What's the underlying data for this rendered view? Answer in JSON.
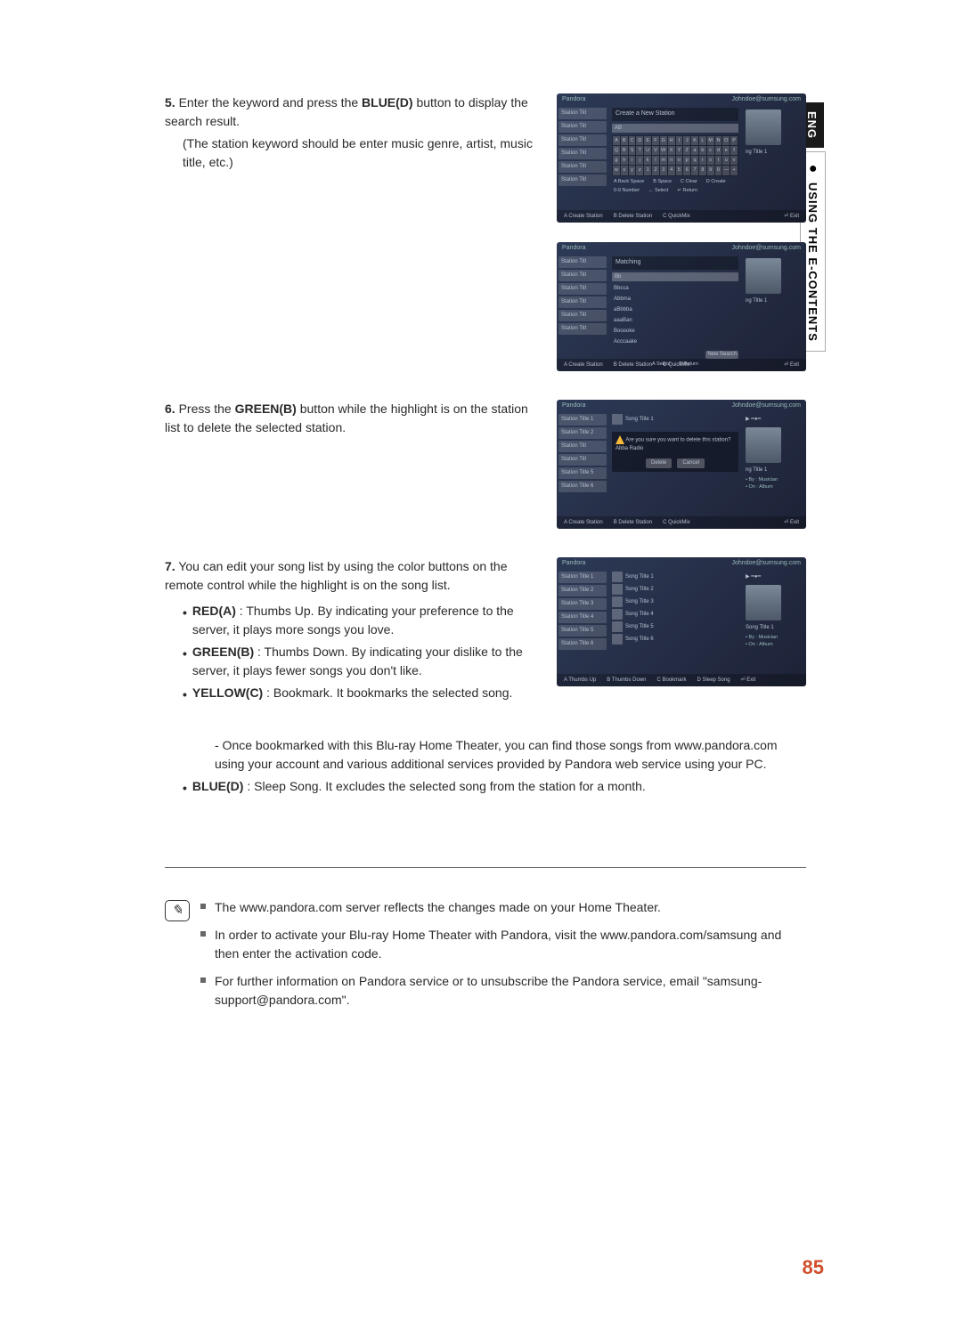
{
  "sidebar": {
    "lang": "ENG",
    "section": "USING THE E-CONTENTS"
  },
  "step5": {
    "num": "5.",
    "text1": "Enter the keyword and press the ",
    "blue": "BLUE(D)",
    "text2": " button to display the search result.",
    "sub": "(The station keyword should be enter music genre, artist, music title, etc.)"
  },
  "step6": {
    "num": "6.",
    "text1": "Press the ",
    "green": "GREEN(B)",
    "text2": " button while the highlight is on the station list to delete the selected station."
  },
  "step7": {
    "num": "7.",
    "intro": "You can edit your song list by using the color buttons on the remote control while the highlight is on the song list.",
    "red_label": "RED(A)",
    "red_text": " : Thumbs Up. By indicating your preference to the server, it plays more songs you love.",
    "green_label": "GREEN(B)",
    "green_text": " : Thumbs Down. By indicating your dislike to the server, it plays fewer songs you don't like.",
    "yellow_label": "YELLOW(C)",
    "yellow_text": " : Bookmark. It bookmarks the selected song.",
    "yellow_sub": "- Once bookmarked with this Blu-ray Home Theater, you can find those songs from www.pandora.com using your account and various additional services provided by Pandora web service using your PC.",
    "blue_label": "BLUE(D)",
    "blue_text": " : Sleep Song. It excludes the selected song from the station for a month."
  },
  "notes": {
    "n1": "The www.pandora.com server reflects the changes made on your Home Theater.",
    "n2": "In order to activate your Blu-ray Home Theater with Pandora, visit the www.pandora.com/samsung and then enter the activation code.",
    "n3": "For further information on Pandora service or to unsubscribe the Pandora service, email \"samsung-support@pandora.com\"."
  },
  "scr": {
    "app": "Pandora",
    "account": "Johndoe@sumsung.com",
    "stations": [
      "Station Titl",
      "Station Titl",
      "Station Titl",
      "Station Titl",
      "Station Titl",
      "Station Titl"
    ],
    "stations_full": [
      "Station Title 1",
      "Station Title 2",
      "Station Title 3",
      "Station Title 4",
      "Station Title 5",
      "Station Title 6"
    ],
    "create_title": "Create a New Station",
    "input": "AB",
    "keys": [
      "A",
      "B",
      "C",
      "D",
      "E",
      "F",
      "G",
      "H",
      "I",
      "J",
      "K",
      "L",
      "M",
      "N",
      "O",
      "P",
      "Q",
      "R",
      "S",
      "T",
      "U",
      "V",
      "W",
      "X",
      "Y",
      "Z",
      "a",
      "b",
      "c",
      "d",
      "e",
      "f",
      "g",
      "h",
      "i",
      "j",
      "k",
      "l",
      "m",
      "n",
      "o",
      "p",
      "q",
      "r",
      "s",
      "t",
      "u",
      "v",
      "w",
      "x",
      "y",
      "z",
      "1",
      "2",
      "3",
      "4",
      "5",
      "6",
      "7",
      "8",
      "9",
      "0",
      "—",
      "+",
      "=",
      ".",
      "-",
      "!",
      "@",
      "#",
      "$",
      "%",
      "^",
      "&",
      "(",
      ")",
      "/",
      "?",
      "|"
    ],
    "key_hints": [
      "A Back Space",
      "B Space",
      "C Clear",
      "D Create"
    ],
    "key_hints2": [
      "0-9 Number",
      "← Select",
      "↵ Return"
    ],
    "footer1": [
      "A Create Station",
      "B Delete Station",
      "C QuickMix"
    ],
    "footer_exit": "⏎ Exit",
    "matching": "Matching",
    "match_input": "Bb",
    "matches": [
      "Bbcca",
      "Abbma",
      "aBbbba",
      "aaaBan",
      "Booooke",
      "Acccaake"
    ],
    "new_search": "New Search",
    "match_hints": [
      "A Select",
      "B Return"
    ],
    "dialog": "Are you sure you want to delete this station? Abba Radio",
    "delete": "Delete",
    "cancel": "Cancel",
    "songs": [
      "Song Title 1",
      "Song Title 2",
      "Song Title 3",
      "Song Title 4",
      "Song Title 5",
      "Song Title 6"
    ],
    "nowplaying": "Song Title 1",
    "nowplaying_alt": "ng Title 1",
    "by": "By : Musician",
    "on": "On : Album",
    "footer4": [
      "A Thumbs Up",
      "B Thumbs Down",
      "C Bookmark",
      "D Sleep Song",
      "⏎ Exit"
    ]
  },
  "page": "85"
}
